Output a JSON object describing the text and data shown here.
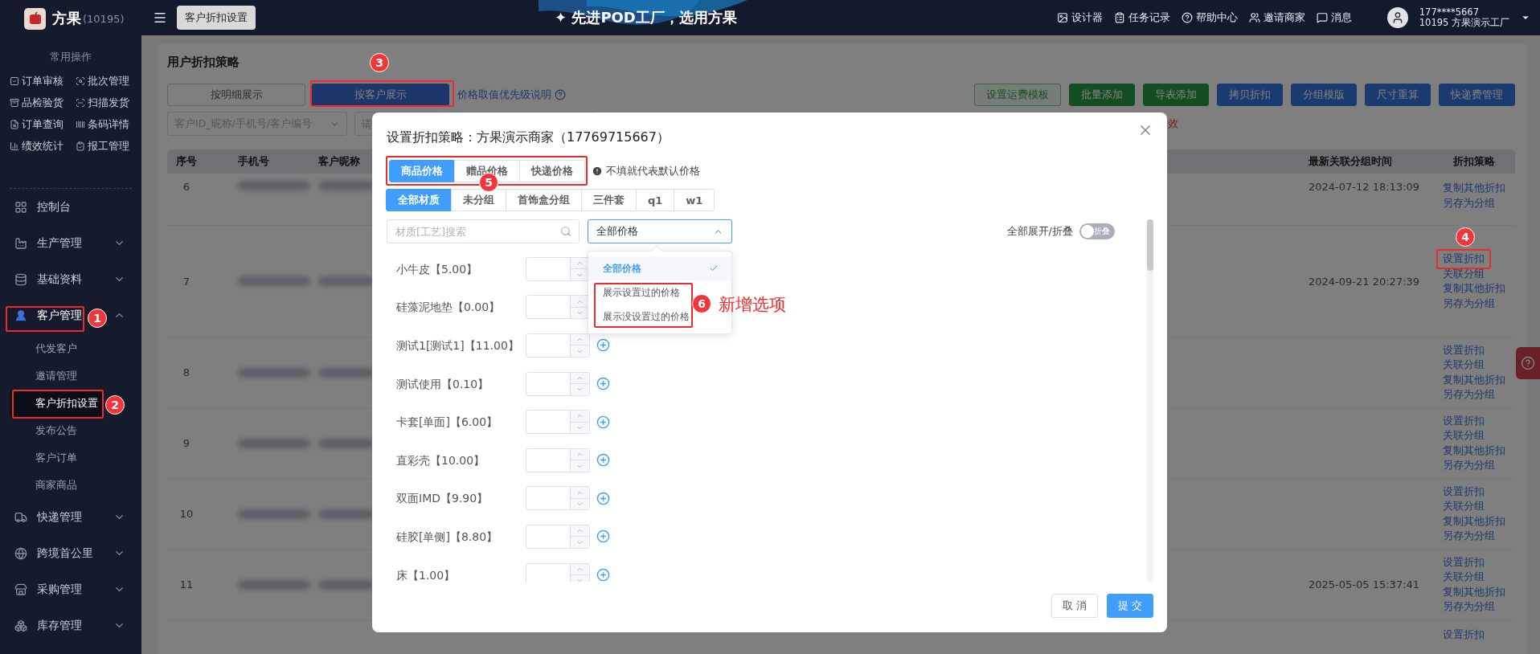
{
  "sidebar": {
    "brand": "方果",
    "account": "(10195)",
    "quick_title": "常用操作",
    "quick_actions": [
      {
        "label": "订单审核"
      },
      {
        "label": "批次管理"
      },
      {
        "label": "品检验货"
      },
      {
        "label": "扫描发货"
      },
      {
        "label": "订单查询"
      },
      {
        "label": "条码详情"
      },
      {
        "label": "绩效统计"
      },
      {
        "label": "报工管理"
      }
    ],
    "nav": [
      {
        "kind": "link",
        "label": "控制台"
      },
      {
        "kind": "group",
        "label": "生产管理",
        "expanded": false
      },
      {
        "kind": "group",
        "label": "基础资料",
        "expanded": false
      },
      {
        "kind": "group",
        "label": "客户管理",
        "expanded": true,
        "children": [
          {
            "label": "代发客户",
            "selected": false
          },
          {
            "label": "邀请管理",
            "selected": false
          },
          {
            "label": "客户折扣设置",
            "selected": true
          },
          {
            "label": "发布公告",
            "selected": false
          },
          {
            "label": "客户订单",
            "selected": false
          },
          {
            "label": "商家商品",
            "selected": false
          }
        ]
      },
      {
        "kind": "group",
        "label": "快递管理",
        "expanded": false
      },
      {
        "kind": "group",
        "label": "跨境首公里",
        "expanded": false
      },
      {
        "kind": "group",
        "label": "采购管理",
        "expanded": false
      },
      {
        "kind": "group",
        "label": "库存管理",
        "expanded": false
      }
    ]
  },
  "topbar": {
    "tab": "客户折扣设置",
    "sparkle": "✦",
    "slogan": "先进POD工厂，选用方果",
    "links": [
      {
        "label": "设计器"
      },
      {
        "label": "任务记录"
      },
      {
        "label": "帮助中心"
      },
      {
        "label": "邀请商家"
      },
      {
        "label": "消息"
      }
    ],
    "user": {
      "phone": "177****5667",
      "org": "10195 方果演示工厂"
    }
  },
  "page": {
    "title": "用户折扣策略",
    "view_tabs": [
      {
        "label": "按明细展示",
        "selected": false
      },
      {
        "label": "按客户展示",
        "selected": true
      }
    ],
    "priority_link": "价格取值优先级说明",
    "actions": [
      {
        "label": "设置运费模板",
        "kind": "outline"
      },
      {
        "label": "批量添加",
        "kind": "success"
      },
      {
        "label": "导表添加",
        "kind": "success"
      },
      {
        "label": "拷贝折扣",
        "kind": "primary"
      },
      {
        "label": "分组模版",
        "kind": "primary"
      },
      {
        "label": "尺寸重算",
        "kind": "primary"
      },
      {
        "label": "快递费管理",
        "kind": "primary"
      }
    ],
    "filters": {
      "customer_placeholder": "客户ID_昵称/手机号/客户编号",
      "second_placeholder": "请",
      "note": "效"
    }
  },
  "table": {
    "columns": [
      "序号",
      "手机号",
      "客户昵称",
      "最新关联分组时间",
      "折扣策略"
    ],
    "rows": [
      {
        "no": "6",
        "time": "2024-07-12 18:13:09",
        "actions": [
          "复制其他折扣",
          "另存为分组"
        ]
      },
      {
        "no": "7",
        "time": "2024-09-21 20:27:39",
        "actions": [
          "设置折扣",
          "关联分组",
          "复制其他折扣",
          "另存为分组"
        ]
      },
      {
        "no": "8",
        "actions": [
          "设置折扣",
          "关联分组",
          "复制其他折扣",
          "另存为分组"
        ]
      },
      {
        "no": "9",
        "actions": [
          "设置折扣",
          "关联分组",
          "复制其他折扣",
          "另存为分组"
        ]
      },
      {
        "no": "10",
        "actions": [
          "设置折扣",
          "关联分组",
          "复制其他折扣",
          "另存为分组"
        ]
      },
      {
        "no": "11",
        "time": "2025-05-05 15:37:41",
        "actions": [
          "设置折扣",
          "关联分组",
          "复制其他折扣",
          "另存为分组"
        ]
      },
      {
        "actions": [
          "设置折扣"
        ]
      }
    ]
  },
  "modal": {
    "title": "设置折扣策略：方果演示商家（17769715667）",
    "price_tabs": [
      {
        "label": "商品价格",
        "selected": true
      },
      {
        "label": "赠品价格",
        "selected": false
      },
      {
        "label": "快递价格",
        "selected": false
      }
    ],
    "hint": "不填就代表默认价格",
    "groups": [
      {
        "label": "全部材质",
        "selected": true
      },
      {
        "label": "未分组",
        "selected": false
      },
      {
        "label": "首饰盒分组",
        "selected": false
      },
      {
        "label": "三件套",
        "selected": false
      },
      {
        "label": "q1",
        "selected": false
      },
      {
        "label": "w1",
        "selected": false
      }
    ],
    "search_placeholder": "材质[工艺]搜索",
    "price_filter": {
      "value": "全部价格",
      "open": true,
      "options": [
        {
          "label": "全部价格",
          "selected": true
        },
        {
          "label": "展示设置过的价格",
          "selected": false
        },
        {
          "label": "展示没设置过的价格",
          "selected": false
        }
      ]
    },
    "toggle": {
      "label": "全部展开/折叠",
      "text": "折叠",
      "on": false
    },
    "materials": [
      {
        "label": "小牛皮【5.00】"
      },
      {
        "label": "硅藻泥地垫【0.00】"
      },
      {
        "label": "测试1[测试1]【11.00】"
      },
      {
        "label": "测试使用【0.10】"
      },
      {
        "label": "卡套[单面]【6.00】"
      },
      {
        "label": "直彩壳【10.00】"
      },
      {
        "label": "双面IMD【9.90】"
      },
      {
        "label": "硅胶[单侧]【8.80】"
      },
      {
        "label": "床【1.00】"
      }
    ],
    "cancel": "取 消",
    "submit": "提 交"
  },
  "annotations": [
    {
      "label": "1"
    },
    {
      "label": "2"
    },
    {
      "label": "3"
    },
    {
      "label": "4"
    },
    {
      "label": "5"
    },
    {
      "label": "6",
      "note": "新增选项"
    }
  ]
}
